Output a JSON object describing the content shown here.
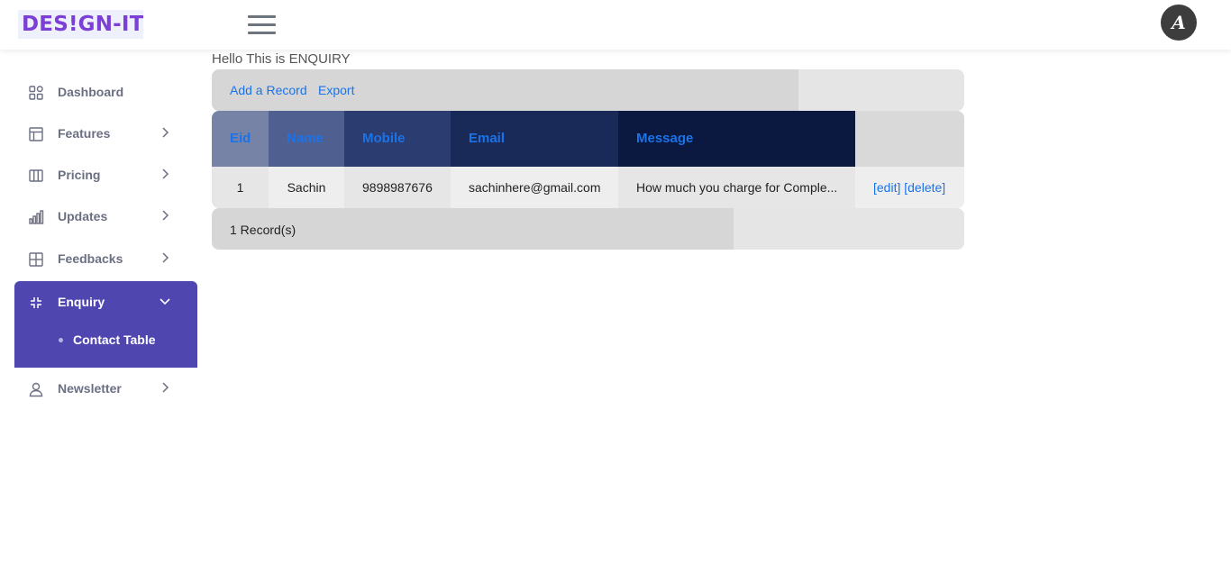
{
  "header": {
    "logo": "DES!GN-IT",
    "avatar_letter": "A"
  },
  "sidebar": {
    "items": [
      {
        "label": "Dashboard",
        "icon": "dashboard-grid-icon"
      },
      {
        "label": "Features",
        "icon": "layout-icon"
      },
      {
        "label": "Pricing",
        "icon": "columns-icon"
      },
      {
        "label": "Updates",
        "icon": "bar-chart-icon"
      },
      {
        "label": "Feedbacks",
        "icon": "table-grid-icon"
      },
      {
        "label": "Enquiry",
        "icon": "minimize-arrows-icon"
      },
      {
        "label": "Newsletter",
        "icon": "user-icon"
      }
    ],
    "enquiry_sub": "Contact Table",
    "active_color": "#4f46b0"
  },
  "main": {
    "greeting": "Hello This is ENQUIRY",
    "toolbar": {
      "add_label": "Add a Record",
      "export_label": "Export"
    },
    "table": {
      "columns": [
        "Eid",
        "Name",
        "Mobile",
        "Email",
        "Message"
      ],
      "rows": [
        {
          "eid": "1",
          "name": "Sachin",
          "mobile": "9898987676",
          "email": "sachinhere@gmail.com",
          "message": "How much you charge for Comple...",
          "edit": "[edit]",
          "delete": "[delete]"
        }
      ]
    },
    "footer": "1 Record(s)",
    "link_color": "#1a73e8"
  }
}
